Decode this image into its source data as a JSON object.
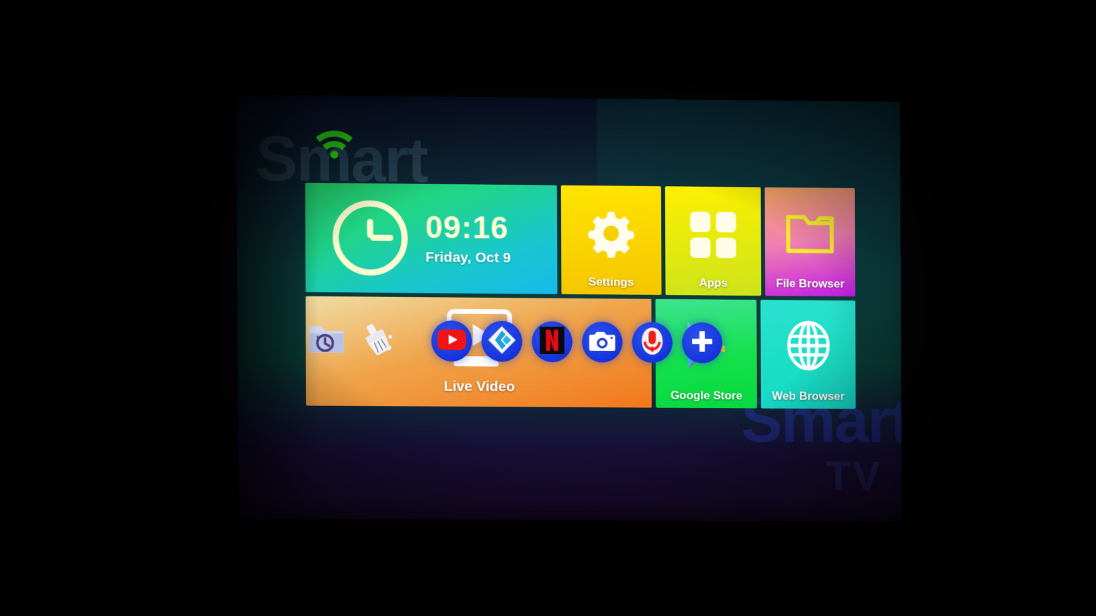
{
  "device": {
    "type": "smart-tv-home-screen",
    "watermark_top": "Smart",
    "watermark_bottom": "Smart",
    "watermark_bottom_sub": "TV",
    "wifi_icon": "wifi-icon",
    "wifi_color": "#2fe014"
  },
  "clock": {
    "time": "09:16",
    "date": "Friday, Oct 9",
    "icon": "clock-icon"
  },
  "tiles": [
    {
      "id": "clock",
      "label": "",
      "icon": "clock-icon",
      "color": "#1fd489"
    },
    {
      "id": "settings",
      "label": "Settings",
      "icon": "gear-icon",
      "color": "#ffe500"
    },
    {
      "id": "apps",
      "label": "Apps",
      "icon": "grid-apps-icon",
      "color": "#fdf000"
    },
    {
      "id": "files",
      "label": "File Browser",
      "icon": "folder-icon",
      "color": "#c21ce6"
    },
    {
      "id": "live",
      "label": "Live Video",
      "icon": "tv-play-icon",
      "color": "#f2761b"
    },
    {
      "id": "store",
      "label": "Google Store",
      "icon": "play-store-icon",
      "color": "#13e04a"
    },
    {
      "id": "web",
      "label": "Web Browser",
      "icon": "globe-icon",
      "color": "#16d9c8"
    }
  ],
  "dock": [
    {
      "id": "recent-files",
      "icon": "folder-history-icon",
      "style": "plain"
    },
    {
      "id": "cleaner",
      "icon": "broom-clean-icon",
      "style": "plain"
    },
    {
      "id": "youtube",
      "icon": "youtube-icon",
      "style": "circle"
    },
    {
      "id": "kodi",
      "icon": "kodi-icon",
      "style": "circle"
    },
    {
      "id": "netflix",
      "icon": "netflix-icon",
      "style": "circle"
    },
    {
      "id": "camera",
      "icon": "camera-icon",
      "style": "circle"
    },
    {
      "id": "voice",
      "icon": "microphone-icon",
      "style": "circle"
    },
    {
      "id": "add",
      "icon": "plus-icon",
      "style": "circle"
    }
  ]
}
